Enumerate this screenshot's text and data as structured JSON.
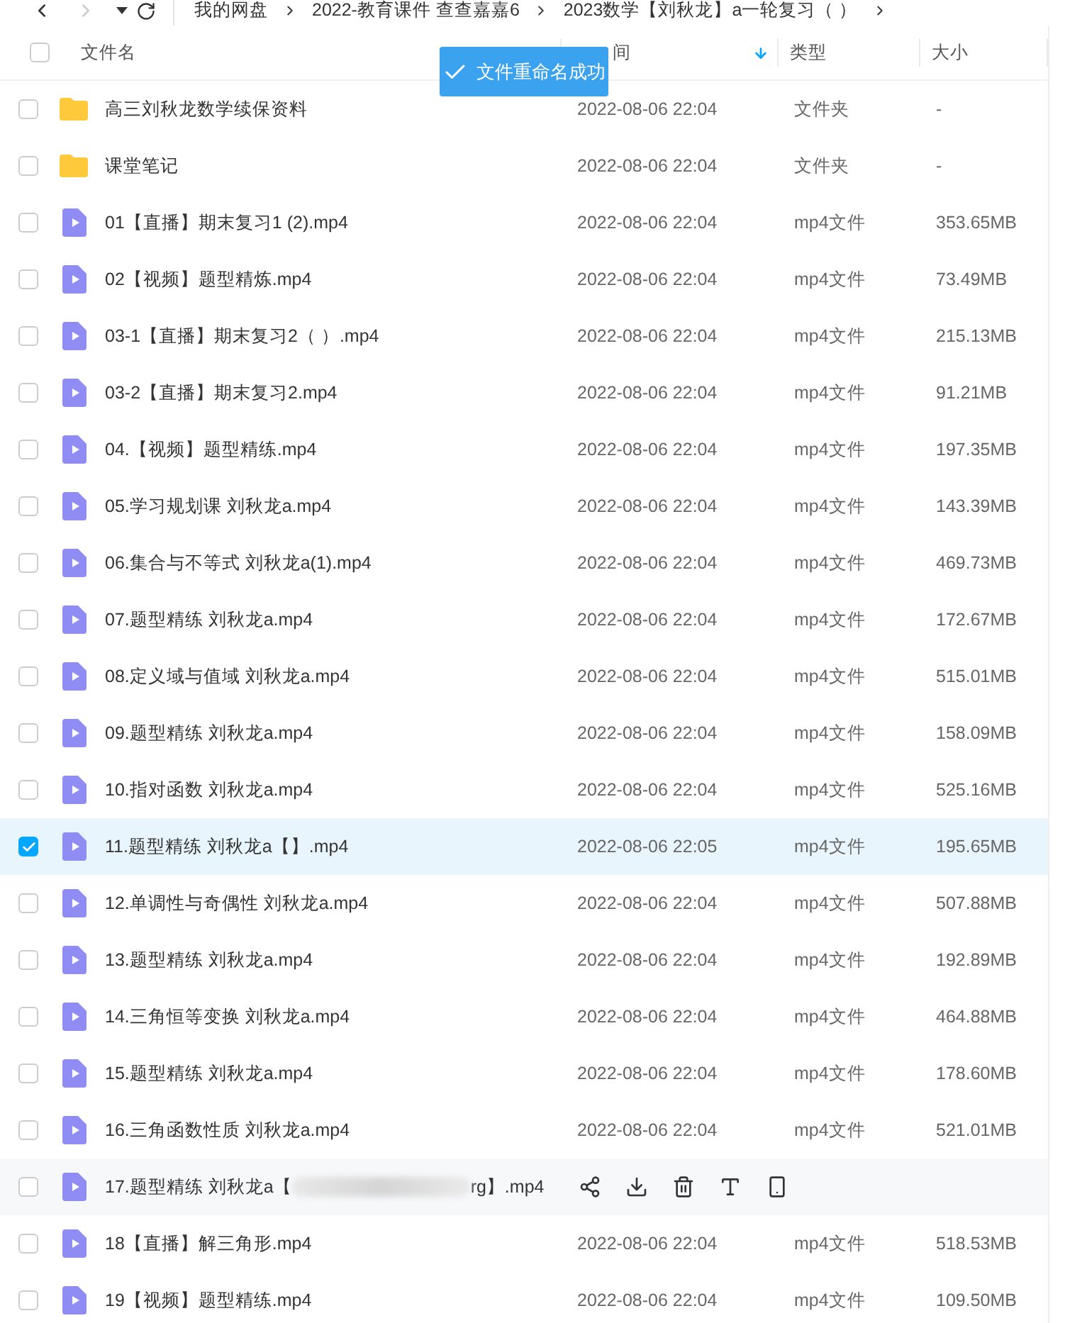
{
  "breadcrumb": [
    "我的网盘",
    "2022-教育课件 查查嘉嘉6",
    "2023数学【刘秋龙】a一轮复习（ ）"
  ],
  "columns": [
    {
      "label": "文件名"
    },
    {
      "label": "间",
      "sorted": true
    },
    {
      "label": "类型"
    },
    {
      "label": "大小"
    }
  ],
  "toast": {
    "text": "文件重命名成功"
  },
  "select_all": {
    "checked": false
  },
  "rows": [
    {
      "kind": "folder",
      "name": "高三刘秋龙数学续保资料",
      "date": "2022-08-06 22:04",
      "type": "文件夹",
      "size": "-",
      "selected": false
    },
    {
      "kind": "folder",
      "name": "课堂笔记",
      "date": "2022-08-06 22:04",
      "type": "文件夹",
      "size": "-",
      "selected": false
    },
    {
      "kind": "video",
      "name": "01【直播】期末复习1 (2).mp4",
      "date": "2022-08-06 22:04",
      "type": "mp4文件",
      "size": "353.65MB",
      "selected": false
    },
    {
      "kind": "video",
      "name": "02【视频】题型精炼.mp4",
      "date": "2022-08-06 22:04",
      "type": "mp4文件",
      "size": "73.49MB",
      "selected": false
    },
    {
      "kind": "video",
      "name": "03-1【直播】期末复习2（ ）.mp4",
      "date": "2022-08-06 22:04",
      "type": "mp4文件",
      "size": "215.13MB",
      "selected": false
    },
    {
      "kind": "video",
      "name": "03-2【直播】期末复习2.mp4",
      "date": "2022-08-06 22:04",
      "type": "mp4文件",
      "size": "91.21MB",
      "selected": false
    },
    {
      "kind": "video",
      "name": "04.【视频】题型精练.mp4",
      "date": "2022-08-06 22:04",
      "type": "mp4文件",
      "size": "197.35MB",
      "selected": false
    },
    {
      "kind": "video",
      "name": "05.学习规划课 刘秋龙a.mp4",
      "date": "2022-08-06 22:04",
      "type": "mp4文件",
      "size": "143.39MB",
      "selected": false
    },
    {
      "kind": "video",
      "name": "06.集合与不等式 刘秋龙a(1).mp4",
      "date": "2022-08-06 22:04",
      "type": "mp4文件",
      "size": "469.73MB",
      "selected": false
    },
    {
      "kind": "video",
      "name": "07.题型精练 刘秋龙a.mp4",
      "date": "2022-08-06 22:04",
      "type": "mp4文件",
      "size": "172.67MB",
      "selected": false
    },
    {
      "kind": "video",
      "name": "08.定义域与值域 刘秋龙a.mp4",
      "date": "2022-08-06 22:04",
      "type": "mp4文件",
      "size": "515.01MB",
      "selected": false
    },
    {
      "kind": "video",
      "name": "09.题型精练 刘秋龙a.mp4",
      "date": "2022-08-06 22:04",
      "type": "mp4文件",
      "size": "158.09MB",
      "selected": false
    },
    {
      "kind": "video",
      "name": "10.指对函数 刘秋龙a.mp4",
      "date": "2022-08-06 22:04",
      "type": "mp4文件",
      "size": "525.16MB",
      "selected": false
    },
    {
      "kind": "video",
      "name": "11.题型精练 刘秋龙a【】.mp4",
      "date": "2022-08-06 22:05",
      "type": "mp4文件",
      "size": "195.65MB",
      "selected": true
    },
    {
      "kind": "video",
      "name": "12.单调性与奇偶性 刘秋龙a.mp4",
      "date": "2022-08-06 22:04",
      "type": "mp4文件",
      "size": "507.88MB",
      "selected": false
    },
    {
      "kind": "video",
      "name": "13.题型精练 刘秋龙a.mp4",
      "date": "2022-08-06 22:04",
      "type": "mp4文件",
      "size": "192.89MB",
      "selected": false
    },
    {
      "kind": "video",
      "name": "14.三角恒等变换 刘秋龙a.mp4",
      "date": "2022-08-06 22:04",
      "type": "mp4文件",
      "size": "464.88MB",
      "selected": false
    },
    {
      "kind": "video",
      "name": "15.题型精练 刘秋龙a.mp4",
      "date": "2022-08-06 22:04",
      "type": "mp4文件",
      "size": "178.60MB",
      "selected": false
    },
    {
      "kind": "video",
      "name": "16.三角函数性质 刘秋龙a.mp4",
      "date": "2022-08-06 22:04",
      "type": "mp4文件",
      "size": "521.01MB",
      "selected": false
    },
    {
      "kind": "hovered",
      "name": "17.题型精练 刘秋龙a【",
      "name_end": "rg】.mp4",
      "selected": false
    },
    {
      "kind": "video",
      "name": "18【直播】解三角形.mp4",
      "date": "2022-08-06 22:04",
      "type": "mp4文件",
      "size": "518.53MB",
      "selected": false
    },
    {
      "kind": "video",
      "name": "19【视频】题型精练.mp4",
      "date": "2022-08-06 22:04",
      "type": "mp4文件",
      "size": "109.50MB",
      "selected": false
    }
  ]
}
